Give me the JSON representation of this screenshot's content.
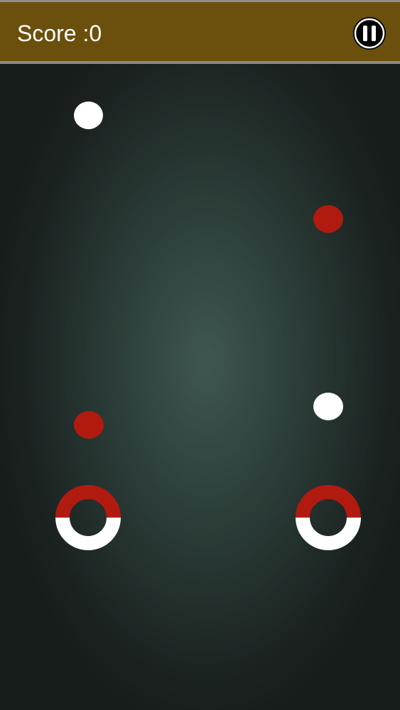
{
  "header": {
    "score_label": "Score :",
    "score_value": 0,
    "pause_icon": "pause-icon"
  },
  "colors": {
    "header_bg": "#6b4f0c",
    "ball_white": "#ffffff",
    "ball_red": "#b11a0f",
    "catcher_top": "#b11a0f",
    "catcher_bottom": "#ffffff",
    "background_center": "#3f5650",
    "background_edge": "#171d1b"
  },
  "falling_balls": [
    {
      "color": "white"
    },
    {
      "color": "red"
    },
    {
      "color": "white"
    },
    {
      "color": "red"
    }
  ],
  "catchers": [
    {
      "side": "left",
      "top_color": "red",
      "bottom_color": "white"
    },
    {
      "side": "right",
      "top_color": "red",
      "bottom_color": "white"
    }
  ]
}
